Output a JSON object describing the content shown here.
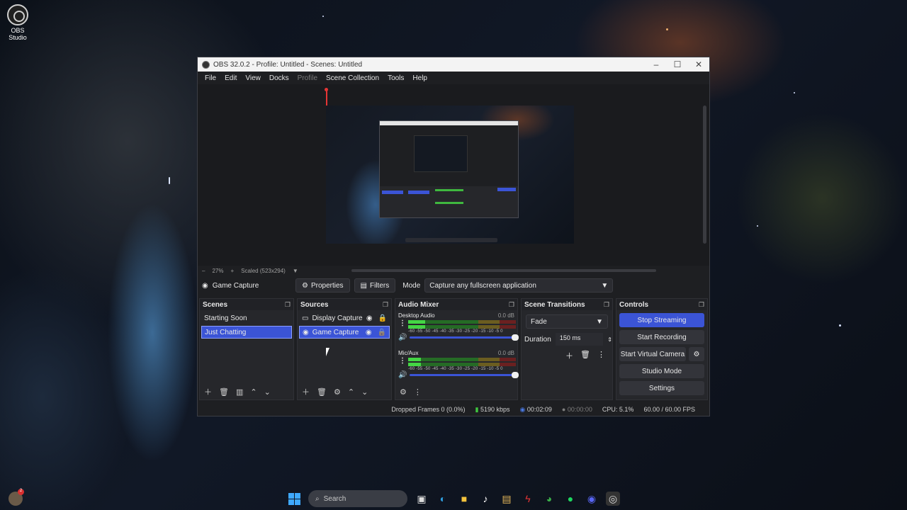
{
  "desktop": {
    "icon_label": "OBS Studio"
  },
  "window": {
    "title": "OBS 32.0.2 - Profile: Untitled - Scenes: Untitled",
    "controls": [
      "–",
      "☐",
      "✕"
    ]
  },
  "menu": [
    "File",
    "Edit",
    "View",
    "Docks",
    "Profile",
    "Scene Collection",
    "Tools",
    "Help"
  ],
  "zoom": {
    "minus": "–",
    "level": "27%",
    "plus": "+",
    "scale": "Scaled (523x294)",
    "dropdown": "▼"
  },
  "source_bar": {
    "source": "Game Capture",
    "properties": "Properties",
    "filters": "Filters",
    "mode_label": "Mode",
    "mode_value": "Capture any fullscreen application"
  },
  "scenes": {
    "title": "Scenes",
    "items": [
      {
        "label": "Starting Soon",
        "selected": false
      },
      {
        "label": "Just Chatting",
        "selected": true
      }
    ]
  },
  "sources": {
    "title": "Sources",
    "items": [
      {
        "label": "Display Capture",
        "selected": false
      },
      {
        "label": "Game Capture",
        "selected": true
      }
    ]
  },
  "audio_mixer": {
    "title": "Audio Mixer",
    "channels": [
      {
        "name": "Desktop Audio",
        "db": "0.0 dB",
        "level": 0.16
      },
      {
        "name": "Mic/Aux",
        "db": "0.0 dB",
        "level": 0.12
      }
    ],
    "ticks": "-60 -55 -50 -45 -40 -35 -30 -25 -20 -15 -10 -5 0"
  },
  "scene_transitions": {
    "title": "Scene Transitions",
    "transition": "Fade",
    "duration_label": "Duration",
    "duration_value": "150 ms"
  },
  "controls": {
    "title": "Controls",
    "stop_streaming": "Stop Streaming",
    "start_recording": "Start Recording",
    "start_virtual_camera": "Start Virtual Camera",
    "studio_mode": "Studio Mode",
    "settings": "Settings"
  },
  "status": {
    "dropped_frames": "Dropped Frames 0 (0.0%)",
    "kbps": "5190 kbps",
    "stream_time": "00:02:09",
    "record_time": "00:00:00",
    "cpu": "CPU: 5.1%",
    "fps": "60.00 / 60.00 FPS"
  },
  "taskbar": {
    "search_placeholder": "Search"
  },
  "colors": {
    "accent": "#3b54d6",
    "meter_green": "#44d644",
    "record_red": "#e53535"
  }
}
